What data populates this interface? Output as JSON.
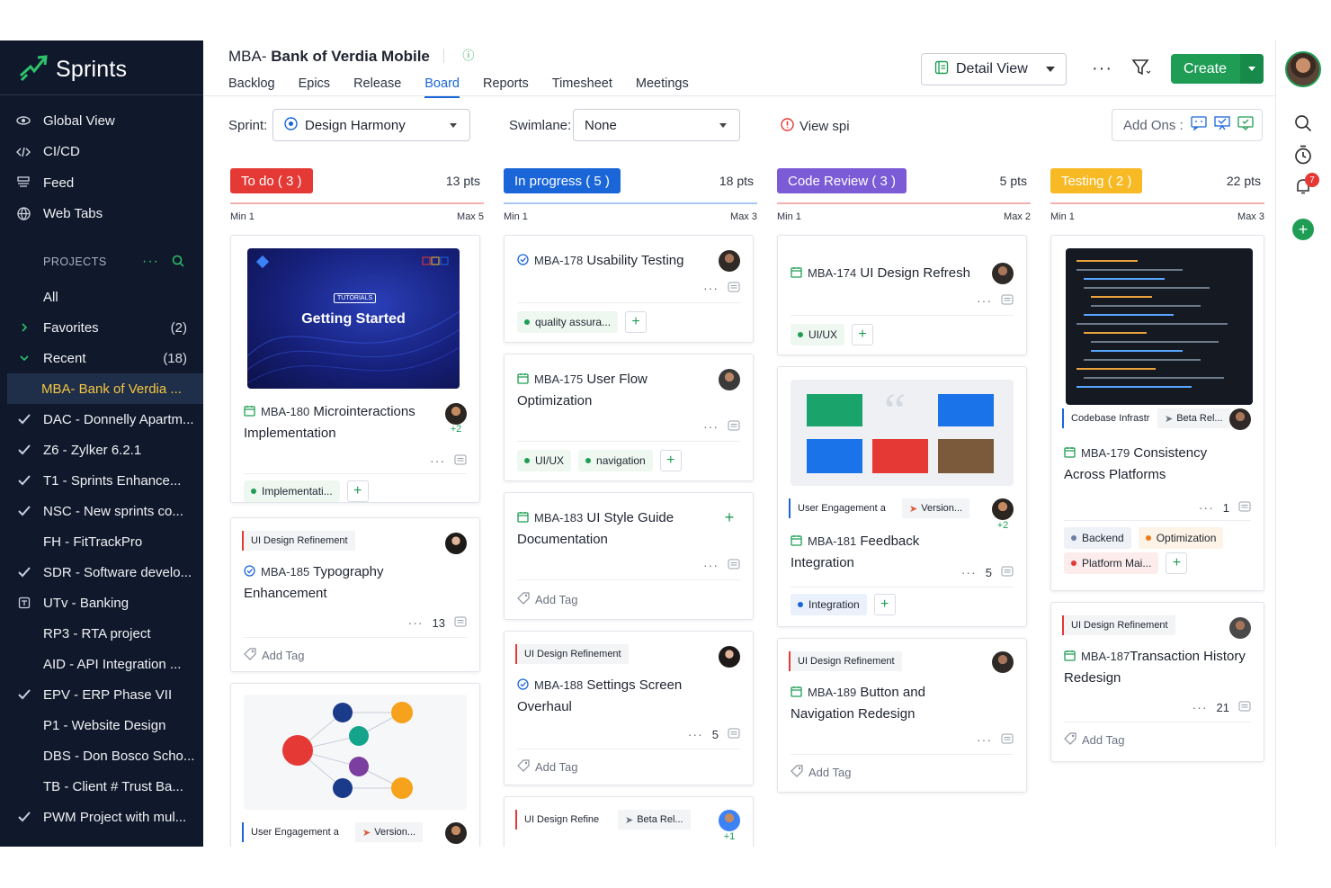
{
  "app": {
    "name": "Sprints"
  },
  "sidebar": {
    "nav": [
      {
        "label": "Global View",
        "icon": "globe-view-icon"
      },
      {
        "label": "CI/CD",
        "icon": "code-icon"
      },
      {
        "label": "Feed",
        "icon": "feed-icon"
      },
      {
        "label": "Web Tabs",
        "icon": "web-icon"
      }
    ],
    "projects_header": "PROJECTS",
    "items": [
      {
        "label": "All",
        "count": "",
        "lead": ""
      },
      {
        "label": "Favorites",
        "count": "(2)",
        "lead": "chevron-right"
      },
      {
        "label": "Recent",
        "count": "(18)",
        "lead": "chevron-down"
      },
      {
        "label": "MBA- Bank of Verdia ...",
        "count": "",
        "lead": "",
        "active": true
      },
      {
        "label": "DAC - Donnelly Apartm...",
        "count": "",
        "lead": "check"
      },
      {
        "label": "Z6  - Zylker 6.2.1",
        "count": "",
        "lead": "check"
      },
      {
        "label": "T1  - Sprints Enhance...",
        "count": "",
        "lead": "check"
      },
      {
        "label": "NSC - New sprints co...",
        "count": "",
        "lead": "check"
      },
      {
        "label": "FH  - FitTrackPro",
        "count": "",
        "lead": ""
      },
      {
        "label": "SDR - Software develo...",
        "count": "",
        "lead": "check"
      },
      {
        "label": "UTv - Banking",
        "count": "",
        "lead": "box"
      },
      {
        "label": "RP3 - RTA project",
        "count": "",
        "lead": ""
      },
      {
        "label": "AID - API Integration ...",
        "count": "",
        "lead": ""
      },
      {
        "label": "EPV - ERP Phase VII",
        "count": "",
        "lead": "check"
      },
      {
        "label": "P1  - Website Design",
        "count": "",
        "lead": ""
      },
      {
        "label": "DBS - Don Bosco Scho...",
        "count": "",
        "lead": ""
      },
      {
        "label": "TB  - Client # Trust Ba...",
        "count": "",
        "lead": ""
      },
      {
        "label": "PWM Project with mul...",
        "count": "",
        "lead": "check"
      }
    ]
  },
  "header": {
    "prefix": "MBA-",
    "title": "Bank of Verdia Mobile",
    "tabs": [
      "Backlog",
      "Epics",
      "Release",
      "Board",
      "Reports",
      "Timesheet",
      "Meetings"
    ],
    "active_tab": "Board",
    "view_select": "Detail View",
    "create_label": "Create"
  },
  "toolbar": {
    "sprint_label": "Sprint:",
    "sprint_value": "Design Harmony",
    "swimlane_label": "Swimlane:",
    "swimlane_value": "None",
    "view_spi": "View spi",
    "addons_label": "Add Ons :"
  },
  "rail": {
    "notification_count": "7"
  },
  "columns": [
    {
      "title": "To do ( 3 )",
      "pts": "13 pts",
      "min": "Min 1",
      "max": "Max 5",
      "color": "#e53935",
      "cards": [
        {
          "key": "MBA-180",
          "title": "Microinteractions Implementation",
          "image_text": "Getting Started",
          "image_badge": "TUTORIALS",
          "more": "+2",
          "tag": "Implementati..."
        },
        {
          "key": "MBA-185",
          "title": "Typography Enhancement",
          "chip": "UI Design Refinement",
          "comments": "13",
          "add_tag": "Add Tag"
        },
        {
          "chip": "User Engagement a",
          "chip2": "Version..."
        }
      ]
    },
    {
      "title": "In progress ( 5 )",
      "pts": "18 pts",
      "min": "Min 1",
      "max": "Max 3",
      "color": "#1a66d9",
      "cards": [
        {
          "key": "MBA-178",
          "title": "Usability Testing",
          "tag": "quality assura..."
        },
        {
          "key": "MBA-175",
          "title": "User Flow Optimization",
          "tags": [
            "UI/UX",
            "navigation"
          ]
        },
        {
          "key": "MBA-183",
          "title": "UI Style Guide Documentation",
          "add_tag": "Add Tag"
        },
        {
          "key": "MBA-188",
          "title": "Settings Screen Overhaul",
          "chip": "UI Design Refinement",
          "comments": "5",
          "add_tag": "Add Tag"
        },
        {
          "chip": "UI Design Refine",
          "chip2": "Beta Rel...",
          "more": "+1"
        }
      ]
    },
    {
      "title": "Code Review ( 3 )",
      "pts": "5 pts",
      "min": "Min 1",
      "max": "Max 2",
      "color": "#7b5bd6",
      "cards": [
        {
          "key": "MBA-174",
          "title": "UI Design Refresh",
          "tag": "UI/UX"
        },
        {
          "key": "MBA-181",
          "title": "Feedback Integration",
          "chip": "User Engagement a",
          "chip2": "Version...",
          "more": "+2",
          "comments": "5",
          "tag": "Integration"
        },
        {
          "key": "MBA-189",
          "title": "Button and Navigation Redesign",
          "chip": "UI Design Refinement",
          "add_tag": "Add Tag"
        }
      ]
    },
    {
      "title": "Testing ( 2 )",
      "pts": "22 pts",
      "min": "Min 1",
      "max": "Max 3",
      "color": "#f7b924",
      "cards": [
        {
          "key": "MBA-179",
          "title": "Consistency Across Platforms",
          "chip": "Codebase Infrastr",
          "chip2": "Beta Rel...",
          "comments": "1",
          "tags": [
            "Backend",
            "Optimization",
            "Platform Mai..."
          ]
        },
        {
          "key": "MBA-187",
          "title": "Transaction History Redesign",
          "chip": "UI Design Refinement",
          "comments": "21",
          "add_tag": "Add Tag"
        }
      ]
    }
  ]
}
